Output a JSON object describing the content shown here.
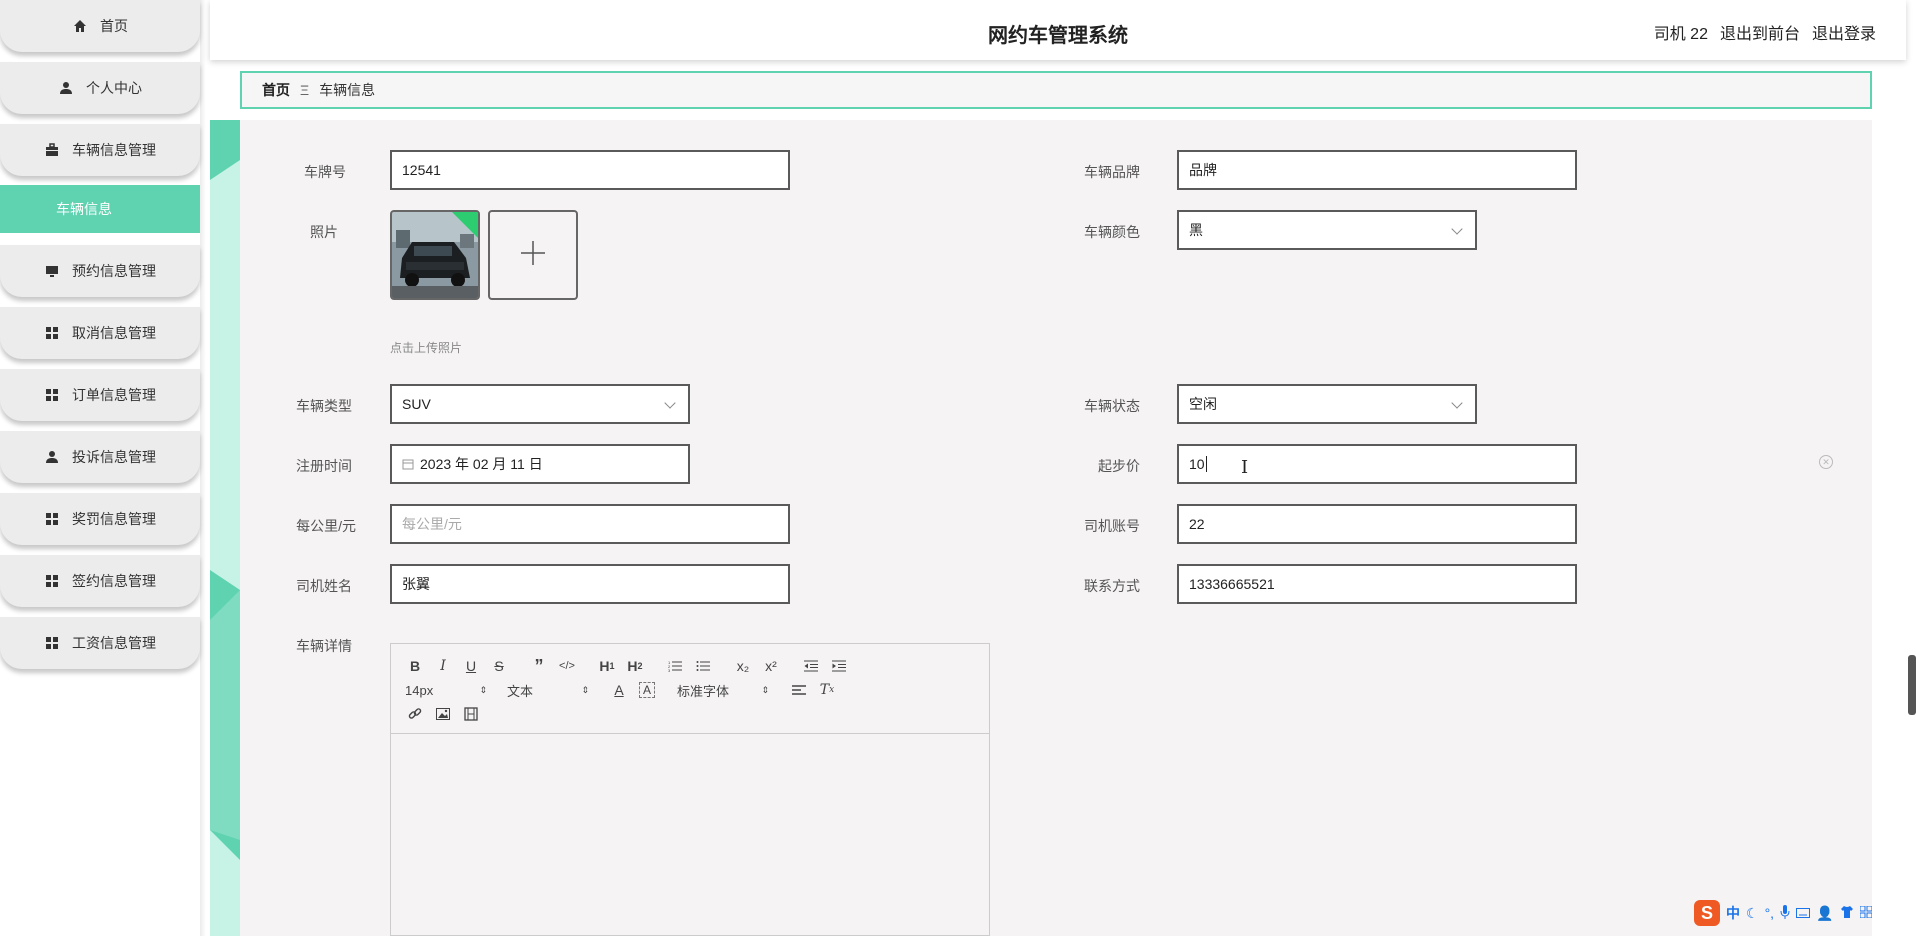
{
  "header": {
    "title": "网约车管理系统",
    "user": "司机 22",
    "to_front": "退出到前台",
    "logout": "退出登录"
  },
  "sidebar": {
    "items": [
      {
        "label": "首页",
        "icon": "home-icon"
      },
      {
        "label": "个人中心",
        "icon": "user-icon"
      },
      {
        "label": "车辆信息管理",
        "icon": "briefcase-icon"
      },
      {
        "label": "车辆信息",
        "icon": ""
      },
      {
        "label": "预约信息管理",
        "icon": "monitor-icon"
      },
      {
        "label": "取消信息管理",
        "icon": "grid-icon"
      },
      {
        "label": "订单信息管理",
        "icon": "grid-icon"
      },
      {
        "label": "投诉信息管理",
        "icon": "user-icon"
      },
      {
        "label": "奖罚信息管理",
        "icon": "grid-icon"
      },
      {
        "label": "签约信息管理",
        "icon": "grid-icon"
      },
      {
        "label": "工资信息管理",
        "icon": "grid-icon"
      }
    ]
  },
  "breadcrumb": {
    "home": "首页",
    "separator": "Ξ",
    "current": "车辆信息"
  },
  "form": {
    "plate": {
      "label": "车牌号",
      "value": "12541"
    },
    "brand": {
      "label": "车辆品牌",
      "value": "品牌"
    },
    "photo": {
      "label": "照片",
      "hint": "点击上传照片"
    },
    "color": {
      "label": "车辆颜色",
      "value": "黑"
    },
    "type": {
      "label": "车辆类型",
      "value": "SUV"
    },
    "status": {
      "label": "车辆状态",
      "value": "空闲"
    },
    "reg_time": {
      "label": "注册时间",
      "value": "2023 年 02 月 11 日"
    },
    "start_price": {
      "label": "起步价",
      "value": "10"
    },
    "per_km": {
      "label": "每公里/元",
      "placeholder": "每公里/元"
    },
    "driver_account": {
      "label": "司机账号",
      "value": "22"
    },
    "driver_name": {
      "label": "司机姓名",
      "value": "张翼"
    },
    "contact": {
      "label": "联系方式",
      "value": "13336665521"
    },
    "detail": {
      "label": "车辆详情"
    }
  },
  "editor": {
    "font_size": "14px",
    "block_format": "文本",
    "font_family": "标准字体",
    "subscript": "x₂",
    "superscript": "x²"
  },
  "colors": {
    "accent": "#5fd2b0",
    "panel_bg": "#f5f3f4"
  },
  "ime": {
    "lang": "中"
  }
}
